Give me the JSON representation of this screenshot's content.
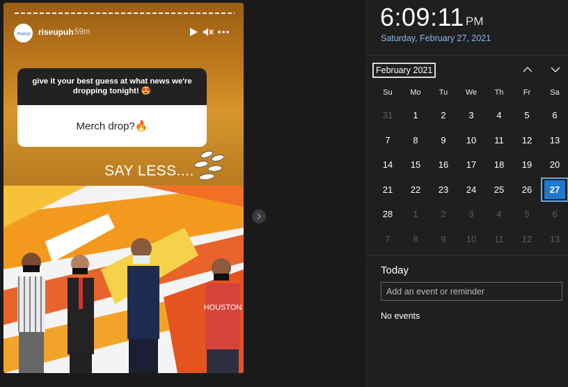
{
  "story": {
    "username": "riseupuh",
    "time_ago": "59m",
    "avatar_text": "RiseUp",
    "question": "give it your best guess at what news we're dropping tonight! 😍",
    "answer": "Merch drop?🔥",
    "caption": "SAY LESS....",
    "shirt_text": "HOUSTON",
    "colors": {
      "accent": "#c07a1e",
      "card_head": "#222222"
    }
  },
  "calendar": {
    "time": "6:09:11",
    "ampm": "PM",
    "date": "Saturday, February 27, 2021",
    "month_label": "February 2021",
    "weekdays": [
      "Su",
      "Mo",
      "Tu",
      "We",
      "Th",
      "Fr",
      "Sa"
    ],
    "days": [
      {
        "d": "31",
        "m": true
      },
      {
        "d": "1"
      },
      {
        "d": "2"
      },
      {
        "d": "3"
      },
      {
        "d": "4"
      },
      {
        "d": "5"
      },
      {
        "d": "6"
      },
      {
        "d": "7"
      },
      {
        "d": "8"
      },
      {
        "d": "9"
      },
      {
        "d": "10"
      },
      {
        "d": "11"
      },
      {
        "d": "12"
      },
      {
        "d": "13"
      },
      {
        "d": "14"
      },
      {
        "d": "15"
      },
      {
        "d": "16"
      },
      {
        "d": "17"
      },
      {
        "d": "18"
      },
      {
        "d": "19"
      },
      {
        "d": "20"
      },
      {
        "d": "21"
      },
      {
        "d": "22"
      },
      {
        "d": "23"
      },
      {
        "d": "24"
      },
      {
        "d": "25"
      },
      {
        "d": "26"
      },
      {
        "d": "27",
        "today": true
      },
      {
        "d": "28"
      },
      {
        "d": "1",
        "m": true
      },
      {
        "d": "2",
        "m": true
      },
      {
        "d": "3",
        "m": true
      },
      {
        "d": "4",
        "m": true
      },
      {
        "d": "5",
        "m": true
      },
      {
        "d": "6",
        "m": true
      },
      {
        "d": "7",
        "m": true
      },
      {
        "d": "8",
        "m": true
      },
      {
        "d": "9",
        "m": true
      },
      {
        "d": "10",
        "m": true
      },
      {
        "d": "11",
        "m": true
      },
      {
        "d": "12",
        "m": true
      },
      {
        "d": "13",
        "m": true
      }
    ],
    "today_label": "Today",
    "event_placeholder": "Add an event or reminder",
    "no_events": "No events",
    "colors": {
      "today_fill": "#1e78d0",
      "date_link": "#8ab8f0"
    }
  }
}
